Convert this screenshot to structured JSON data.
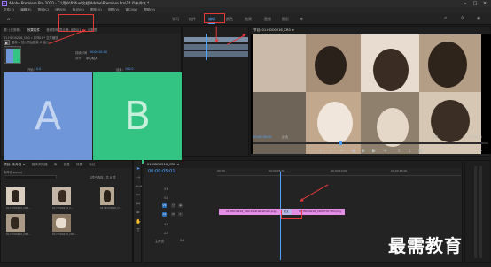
{
  "app": {
    "title": "Adobe Premiere Pro 2020 - C:\\用户\\fhifue\\文档\\Adobe\\Premiere Pro\\14.0\\未命名 *",
    "logo": "Pr"
  },
  "menu": [
    "文件(F)",
    "编辑(E)",
    "剪辑(C)",
    "序列(S)",
    "标记(M)",
    "图形(G)",
    "视图(V)",
    "窗口(W)",
    "帮助(H)"
  ],
  "workspaces": [
    {
      "label": "学习",
      "active": false
    },
    {
      "label": "组件",
      "active": false
    },
    {
      "label": "编辑",
      "active": true
    },
    {
      "label": "颜色",
      "active": false
    },
    {
      "label": "效果",
      "active": false
    },
    {
      "label": "音频",
      "active": false
    },
    {
      "label": "图形",
      "active": false
    },
    {
      "label": "库",
      "active": false
    }
  ],
  "source_panel": {
    "tabs": [
      "源: (无剪辑)",
      "效果控件",
      "音频剪辑混合器: 序列01",
      "元数据"
    ],
    "path_label": "01.HDO0216_CR0 » 序列01 * 交叉缩放",
    "sub_label": "01.HDO0216_CR0 » 序列01",
    "fx_name": "交叉缩放",
    "fx_desc": "图像 A 放大然后图像 B 缩小。",
    "duration_label": "持续时间",
    "duration_value": "00:00:01:00",
    "align_label": "对齐:",
    "align_value": "中心切入",
    "start_label": "开始:",
    "start_value": "0.0",
    "end_label": "结束:",
    "end_value": "100.0",
    "box_a": "A",
    "box_b": "B",
    "show_actual": "显示实际源",
    "reverse": "反向",
    "timecode": "00:00:00:00"
  },
  "program": {
    "tab": "节目: 01.HDO0216_CR0 ≡",
    "timecode": "00:00:00:01",
    "fit": "适合",
    "quality": "完整",
    "end_timecode": "00:00:10:15"
  },
  "project": {
    "tabs": [
      "项目: 未命名 ≡",
      "媒体浏览器",
      "库",
      "信息",
      "效果",
      "标记"
    ],
    "project_file": "未命名.prproj",
    "count": "1项已选择，共 8 项",
    "items": [
      {
        "name": "01.HDO0216_CR0...",
        "dur": "5:00"
      },
      {
        "name": "01.HDO0216_C...",
        "dur": "5:00"
      },
      {
        "name": "01.HDO0216_C...",
        "dur": "5:00"
      },
      {
        "name": "01.HDO0216_CR0...",
        "dur": "5:00"
      },
      {
        "name": "01.HDO0216_CR0...",
        "dur": "5:00"
      }
    ]
  },
  "timeline": {
    "tab": "01.HDO0216_CR0 ≡",
    "timecode": "00:00:05:01",
    "ruler": [
      "00:00",
      "00:00:05:00",
      "00:00:10:00",
      "00:00:15:00"
    ],
    "tracks": [
      "V3",
      "V2",
      "V1",
      "A1",
      "A2",
      "A3"
    ],
    "master_label": "主声道",
    "master_value": "0.0",
    "clip_a": "01.HDO0216_CR0-PrePrePrePrePr.png",
    "clip_b": "01.HDO0216_CR0-THO-THO.png",
    "transition": "交叉"
  },
  "watermark": "最需教育",
  "colors": {
    "accent": "#4ea2ff",
    "annotation": "#e23a3a",
    "clip": "#e48fe6",
    "box_a": "#6f96d8",
    "box_b": "#33c483"
  }
}
